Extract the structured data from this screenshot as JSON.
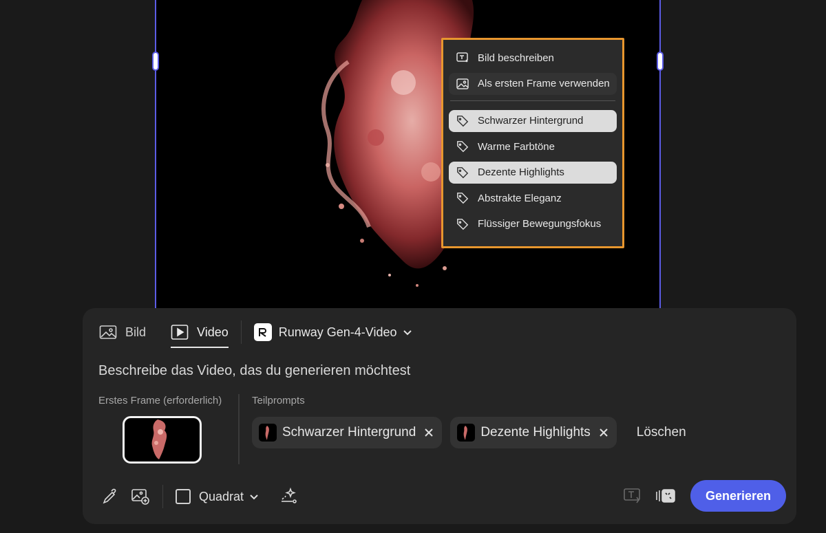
{
  "context_menu": {
    "items": [
      {
        "label": "Bild beschreiben",
        "icon": "describe-image-icon"
      },
      {
        "label": "Als ersten Frame verwenden",
        "icon": "image-icon"
      }
    ],
    "tags": [
      {
        "label": "Schwarzer Hintergrund",
        "icon": "tag-icon",
        "selected": true
      },
      {
        "label": "Warme Farbtöne",
        "icon": "tag-icon",
        "selected": false
      },
      {
        "label": "Dezente Highlights",
        "icon": "tag-icon",
        "selected": true
      },
      {
        "label": "Abstrakte Eleganz",
        "icon": "tag-icon",
        "selected": false
      },
      {
        "label": "Flüssiger Bewegungsfokus",
        "icon": "tag-icon",
        "selected": false
      }
    ]
  },
  "panel": {
    "tabs": [
      {
        "label": "Bild",
        "icon": "image-icon",
        "active": false
      },
      {
        "label": "Video",
        "icon": "video-icon",
        "active": true
      }
    ],
    "model": {
      "label": "Runway Gen-4-Video",
      "icon": "runway-logo-icon"
    },
    "prompt_placeholder": "Beschreibe das Video, das du generieren möchtest",
    "first_frame_label": "Erstes Frame (erforderlich)",
    "subprompts_label": "Teilprompts",
    "chips": [
      {
        "label": "Schwarzer Hintergrund"
      },
      {
        "label": "Dezente Highlights"
      }
    ],
    "clear_label": "Löschen",
    "aspect_label": "Quadrat",
    "generate_label": "Generieren"
  },
  "colors": {
    "accent": "#4f5fe8",
    "menu_outline": "#e8962e",
    "canvas_border": "#5c5ce6"
  }
}
